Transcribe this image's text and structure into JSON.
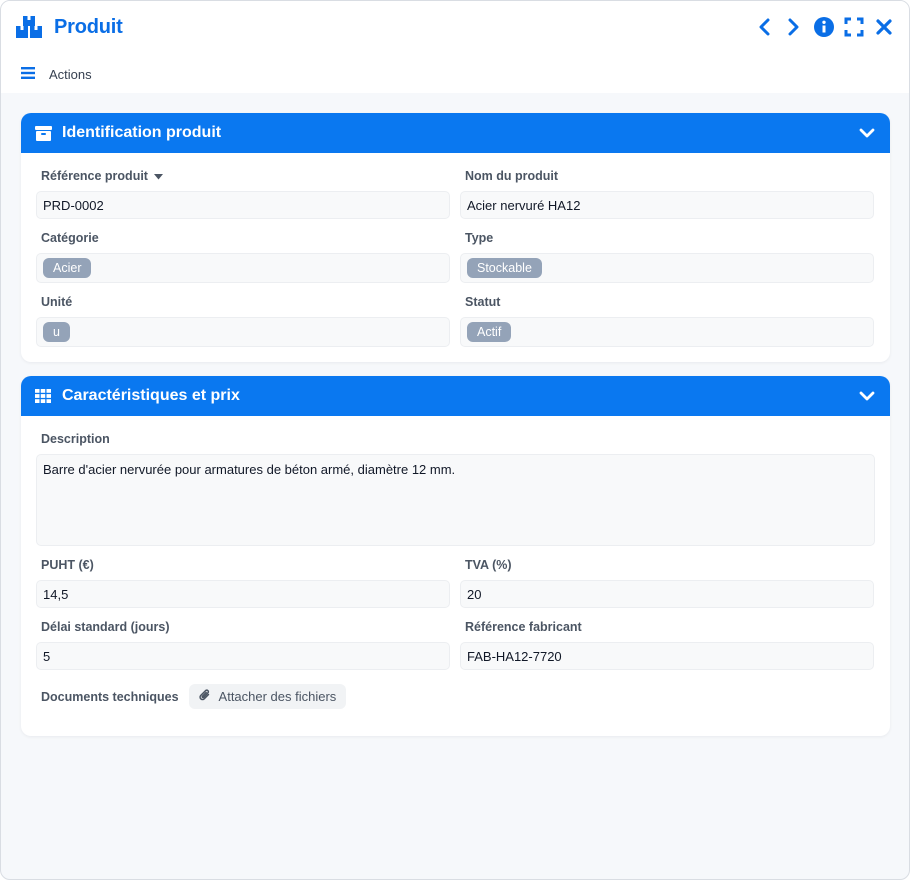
{
  "window": {
    "title": "Produit",
    "icon": "boxes-icon",
    "controls": [
      "chevron-left-icon",
      "chevron-right-icon",
      "info-icon",
      "expand-icon",
      "close-icon"
    ],
    "actions_label": "Actions",
    "accent": "#0a78f0"
  },
  "section_identification": {
    "title": "Identification produit",
    "fields": {
      "reference": {
        "label": "Référence produit",
        "value": "PRD-0002"
      },
      "nom": {
        "label": "Nom du produit",
        "value": "Acier nervuré HA12"
      },
      "categorie": {
        "label": "Catégorie",
        "tag": "Acier"
      },
      "type": {
        "label": "Type",
        "tag": "Stockable"
      },
      "unite": {
        "label": "Unité",
        "tag": "u"
      },
      "statut": {
        "label": "Statut",
        "tag": "Actif"
      }
    }
  },
  "section_caracteristiques": {
    "title": "Caractéristiques et prix",
    "fields": {
      "description": {
        "label": "Description",
        "value": "Barre d'acier nervurée pour armatures de béton armé, diamètre 12 mm."
      },
      "puht": {
        "label": "PUHT (€)",
        "value": "14,5"
      },
      "tva": {
        "label": "TVA (%)",
        "value": "20"
      },
      "delai": {
        "label": "Délai standard (jours)",
        "value": "5"
      },
      "ref_fabricant": {
        "label": "Référence fabricant",
        "value": "FAB-HA12-7720"
      },
      "documents": {
        "label": "Documents techniques",
        "button": "Attacher des fichiers"
      }
    }
  }
}
